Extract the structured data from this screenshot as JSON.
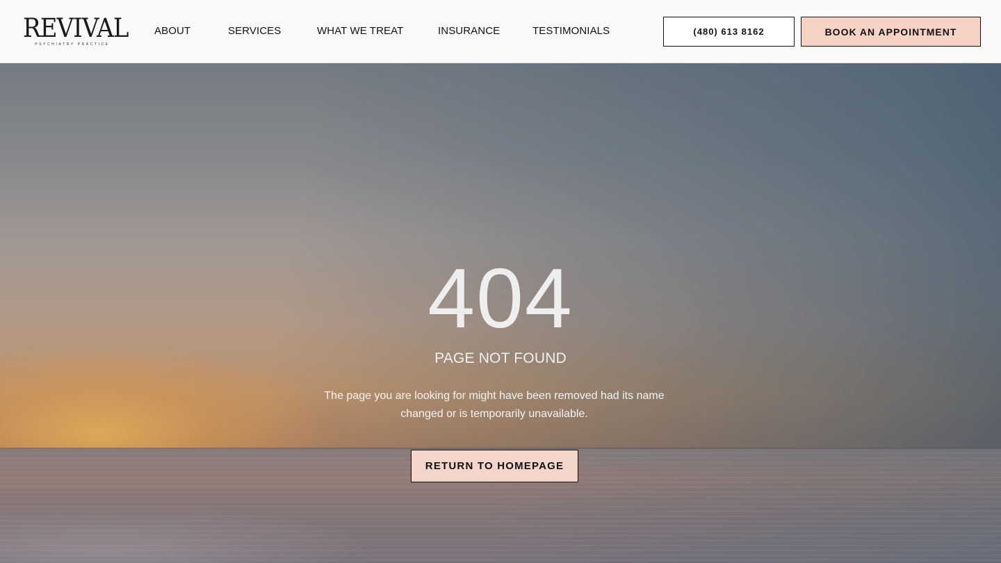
{
  "header": {
    "logo": {
      "wordmark": "REVIVAL",
      "tagline": "PSYCHIATRY PRACTICE"
    },
    "nav": [
      {
        "label": "ABOUT"
      },
      {
        "label": "SERVICES"
      },
      {
        "label": "WHAT WE TREAT"
      },
      {
        "label": "INSURANCE"
      },
      {
        "label": "TESTIMONIALS"
      }
    ],
    "phone_label": "(480) 613 8162",
    "book_label": "BOOK AN APPOINTMENT"
  },
  "hero": {
    "background": "sunset-beach-photo",
    "code": "404",
    "title": "PAGE NOT FOUND",
    "description_line1": "The page you are looking for might have been removed had its name",
    "description_line2": "changed or is temporarily unavailable.",
    "button_label": "RETURN TO HOMEPAGE"
  },
  "colors": {
    "header_bg": "#faf9f7",
    "accent_pink": "#f6d2c4",
    "text_dark": "#111111"
  }
}
